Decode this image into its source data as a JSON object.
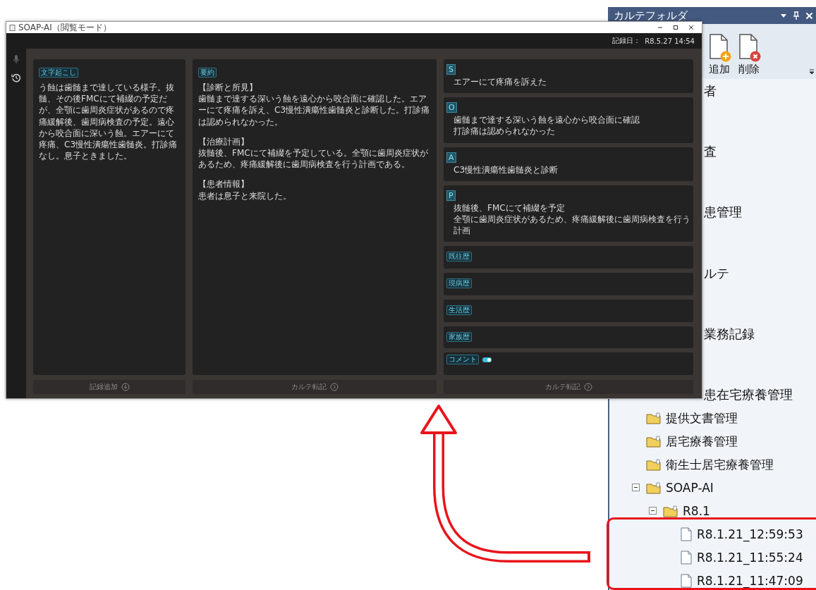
{
  "main_window": {
    "title": "SOAP-AI（閲覧モード）",
    "record_date_label": "記録日：",
    "record_date": "R8.5.27 14:54",
    "transcription": {
      "tag": "文字起こし",
      "text": "う蝕は歯髄まで達している様子。抜髄、その後FMCにて補綴の予定だが、全顎に歯周炎症状があるので疼痛緩解後、歯周病検査の予定。遠心から咬合面に深いう蝕。エアーにて疼痛、C3慢性潰瘍性歯髄炎。打診痛なし。息子ときました。"
    },
    "summary": {
      "tag": "要約",
      "sections": [
        {
          "heading": "【診断と所見】",
          "text": "歯髄まで達する深いう蝕を遠心から咬合面に確認した。エアーにて疼痛を訴え、C3慢性潰瘍性歯髄炎と診断した。打診痛は認められなかった。"
        },
        {
          "heading": "【治療計画】",
          "text": "抜髄後、FMCにて補綴を予定している。全顎に歯周炎症状があるため、疼痛緩解後に歯周病検査を行う計画である。"
        },
        {
          "heading": "【患者情報】",
          "text": "患者は息子と来院した。"
        }
      ]
    },
    "soap": [
      {
        "letter": "S",
        "lines": [
          "エアーにて疼痛を訴えた"
        ]
      },
      {
        "letter": "O",
        "lines": [
          "歯髄まで達する深いう蝕を遠心から咬合面に確認",
          "打診痛は認められなかった"
        ]
      },
      {
        "letter": "A",
        "lines": [
          "C3慢性潰瘍性歯髄炎と診断"
        ]
      },
      {
        "letter": "P",
        "lines": [
          "抜髄後、FMCにて補綴を予定",
          "全顎に歯周炎症状があるため、疼痛緩解後に歯周病検査を行う計画"
        ]
      }
    ],
    "history_fields": [
      "既往歴",
      "現病歴",
      "生活歴",
      "家族歴"
    ],
    "comment": {
      "tag": "コメント",
      "on": true
    },
    "footer_buttons": [
      {
        "label": "記録追加",
        "kind": "down"
      },
      {
        "label": "カルテ転記",
        "kind": "right"
      },
      {
        "label": "カルテ転記",
        "kind": "right"
      }
    ]
  },
  "folder_panel": {
    "title": "カルテフォルダ",
    "toolbar": [
      {
        "label": "追加",
        "kind": "add"
      },
      {
        "label": "削除",
        "kind": "delete"
      }
    ],
    "covered_items": [
      "者",
      "査",
      "患管理",
      "ルテ",
      "業務記録",
      "患在宅療養管理"
    ],
    "tree": [
      {
        "label": "提供文書管理",
        "kind": "folder"
      },
      {
        "label": "居宅療養管理",
        "kind": "folder"
      },
      {
        "label": "衛生士居宅療養管理",
        "kind": "folder"
      },
      {
        "label": "SOAP-AI",
        "kind": "folder",
        "expanded": true,
        "children": [
          {
            "label": "R8.1",
            "kind": "folder",
            "expanded": true,
            "children": [
              {
                "label": "R8.1.21_12:59:53",
                "kind": "document"
              },
              {
                "label": "R8.1.21_11:55:24",
                "kind": "document"
              },
              {
                "label": "R8.1.21_11:47:09",
                "kind": "document"
              }
            ]
          }
        ]
      }
    ]
  }
}
